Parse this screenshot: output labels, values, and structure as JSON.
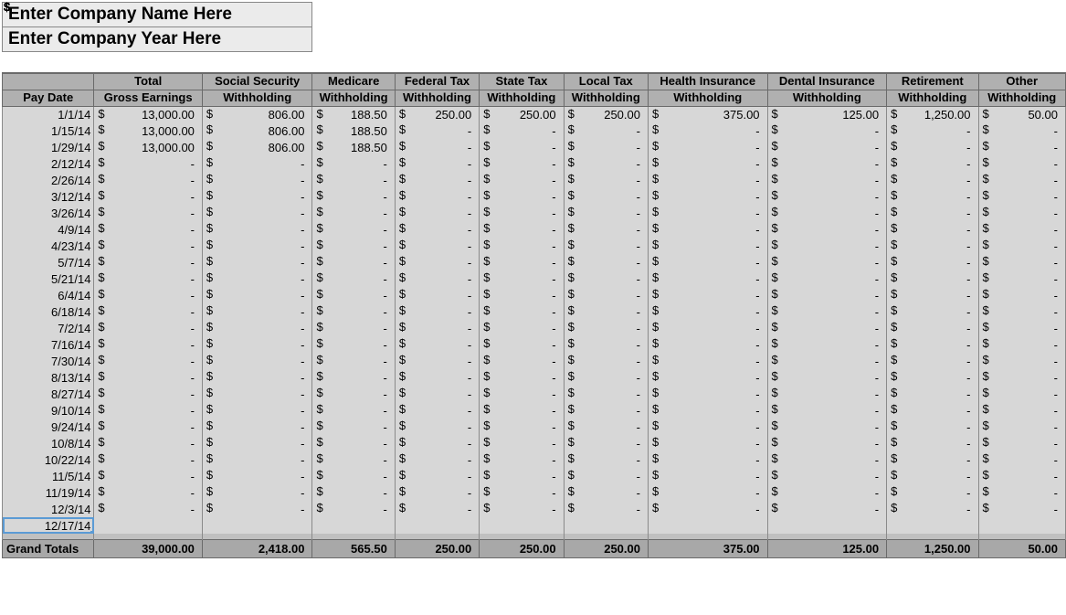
{
  "titles": {
    "company_name": "Enter Company Name Here",
    "company_year": "Enter Company Year Here"
  },
  "columns": [
    {
      "key": "date",
      "h1": "",
      "h2": "Pay Date",
      "cls": "c-date"
    },
    {
      "key": "gross",
      "h1": "Total",
      "h2": "Gross Earnings",
      "cls": "c-gross"
    },
    {
      "key": "ss",
      "h1": "Social Security",
      "h2": "Withholding",
      "cls": "c-ss"
    },
    {
      "key": "med",
      "h1": "Medicare",
      "h2": "Withholding",
      "cls": "c-med"
    },
    {
      "key": "fed",
      "h1": "Federal Tax",
      "h2": "Withholding",
      "cls": "c-fed"
    },
    {
      "key": "state",
      "h1": "State Tax",
      "h2": "Withholding",
      "cls": "c-state"
    },
    {
      "key": "local",
      "h1": "Local Tax",
      "h2": "Withholding",
      "cls": "c-local"
    },
    {
      "key": "health",
      "h1": "Health Insurance",
      "h2": "Withholding",
      "cls": "c-health"
    },
    {
      "key": "dental",
      "h1": "Dental Insurance",
      "h2": "Withholding",
      "cls": "c-dental"
    },
    {
      "key": "ret",
      "h1": "Retirement",
      "h2": "Withholding",
      "cls": "c-ret"
    },
    {
      "key": "other",
      "h1": "Other",
      "h2": "Withholding",
      "cls": "c-other"
    }
  ],
  "rows": [
    {
      "date": "1/1/14",
      "gross": "13,000.00",
      "ss": "806.00",
      "med": "188.50",
      "fed": "250.00",
      "state": "250.00",
      "local": "250.00",
      "health": "375.00",
      "dental": "125.00",
      "ret": "1,250.00",
      "other": "50.00"
    },
    {
      "date": "1/15/14",
      "gross": "13,000.00",
      "ss": "806.00",
      "med": "188.50",
      "fed": "-",
      "state": "-",
      "local": "-",
      "health": "-",
      "dental": "-",
      "ret": "-",
      "other": "-"
    },
    {
      "date": "1/29/14",
      "gross": "13,000.00",
      "ss": "806.00",
      "med": "188.50",
      "fed": "-",
      "state": "-",
      "local": "-",
      "health": "-",
      "dental": "-",
      "ret": "-",
      "other": "-"
    },
    {
      "date": "2/12/14",
      "gross": "-",
      "ss": "-",
      "med": "-",
      "fed": "-",
      "state": "-",
      "local": "-",
      "health": "-",
      "dental": "-",
      "ret": "-",
      "other": "-"
    },
    {
      "date": "2/26/14",
      "gross": "-",
      "ss": "-",
      "med": "-",
      "fed": "-",
      "state": "-",
      "local": "-",
      "health": "-",
      "dental": "-",
      "ret": "-",
      "other": "-"
    },
    {
      "date": "3/12/14",
      "gross": "-",
      "ss": "-",
      "med": "-",
      "fed": "-",
      "state": "-",
      "local": "-",
      "health": "-",
      "dental": "-",
      "ret": "-",
      "other": "-"
    },
    {
      "date": "3/26/14",
      "gross": "-",
      "ss": "-",
      "med": "-",
      "fed": "-",
      "state": "-",
      "local": "-",
      "health": "-",
      "dental": "-",
      "ret": "-",
      "other": "-"
    },
    {
      "date": "4/9/14",
      "gross": "-",
      "ss": "-",
      "med": "-",
      "fed": "-",
      "state": "-",
      "local": "-",
      "health": "-",
      "dental": "-",
      "ret": "-",
      "other": "-"
    },
    {
      "date": "4/23/14",
      "gross": "-",
      "ss": "-",
      "med": "-",
      "fed": "-",
      "state": "-",
      "local": "-",
      "health": "-",
      "dental": "-",
      "ret": "-",
      "other": "-"
    },
    {
      "date": "5/7/14",
      "gross": "-",
      "ss": "-",
      "med": "-",
      "fed": "-",
      "state": "-",
      "local": "-",
      "health": "-",
      "dental": "-",
      "ret": "-",
      "other": "-"
    },
    {
      "date": "5/21/14",
      "gross": "-",
      "ss": "-",
      "med": "-",
      "fed": "-",
      "state": "-",
      "local": "-",
      "health": "-",
      "dental": "-",
      "ret": "-",
      "other": "-"
    },
    {
      "date": "6/4/14",
      "gross": "-",
      "ss": "-",
      "med": "-",
      "fed": "-",
      "state": "-",
      "local": "-",
      "health": "-",
      "dental": "-",
      "ret": "-",
      "other": "-"
    },
    {
      "date": "6/18/14",
      "gross": "-",
      "ss": "-",
      "med": "-",
      "fed": "-",
      "state": "-",
      "local": "-",
      "health": "-",
      "dental": "-",
      "ret": "-",
      "other": "-"
    },
    {
      "date": "7/2/14",
      "gross": "-",
      "ss": "-",
      "med": "-",
      "fed": "-",
      "state": "-",
      "local": "-",
      "health": "-",
      "dental": "-",
      "ret": "-",
      "other": "-"
    },
    {
      "date": "7/16/14",
      "gross": "-",
      "ss": "-",
      "med": "-",
      "fed": "-",
      "state": "-",
      "local": "-",
      "health": "-",
      "dental": "-",
      "ret": "-",
      "other": "-"
    },
    {
      "date": "7/30/14",
      "gross": "-",
      "ss": "-",
      "med": "-",
      "fed": "-",
      "state": "-",
      "local": "-",
      "health": "-",
      "dental": "-",
      "ret": "-",
      "other": "-"
    },
    {
      "date": "8/13/14",
      "gross": "-",
      "ss": "-",
      "med": "-",
      "fed": "-",
      "state": "-",
      "local": "-",
      "health": "-",
      "dental": "-",
      "ret": "-",
      "other": "-"
    },
    {
      "date": "8/27/14",
      "gross": "-",
      "ss": "-",
      "med": "-",
      "fed": "-",
      "state": "-",
      "local": "-",
      "health": "-",
      "dental": "-",
      "ret": "-",
      "other": "-"
    },
    {
      "date": "9/10/14",
      "gross": "-",
      "ss": "-",
      "med": "-",
      "fed": "-",
      "state": "-",
      "local": "-",
      "health": "-",
      "dental": "-",
      "ret": "-",
      "other": "-"
    },
    {
      "date": "9/24/14",
      "gross": "-",
      "ss": "-",
      "med": "-",
      "fed": "-",
      "state": "-",
      "local": "-",
      "health": "-",
      "dental": "-",
      "ret": "-",
      "other": "-"
    },
    {
      "date": "10/8/14",
      "gross": "-",
      "ss": "-",
      "med": "-",
      "fed": "-",
      "state": "-",
      "local": "-",
      "health": "-",
      "dental": "-",
      "ret": "-",
      "other": "-"
    },
    {
      "date": "10/22/14",
      "gross": "-",
      "ss": "-",
      "med": "-",
      "fed": "-",
      "state": "-",
      "local": "-",
      "health": "-",
      "dental": "-",
      "ret": "-",
      "other": "-"
    },
    {
      "date": "11/5/14",
      "gross": "-",
      "ss": "-",
      "med": "-",
      "fed": "-",
      "state": "-",
      "local": "-",
      "health": "-",
      "dental": "-",
      "ret": "-",
      "other": "-"
    },
    {
      "date": "11/19/14",
      "gross": "-",
      "ss": "-",
      "med": "-",
      "fed": "-",
      "state": "-",
      "local": "-",
      "health": "-",
      "dental": "-",
      "ret": "-",
      "other": "-"
    },
    {
      "date": "12/3/14",
      "gross": "-",
      "ss": "-",
      "med": "-",
      "fed": "-",
      "state": "-",
      "local": "-",
      "health": "-",
      "dental": "-",
      "ret": "-",
      "other": "-"
    },
    {
      "date": "12/17/14",
      "gross": "",
      "ss": "",
      "med": "",
      "fed": "",
      "state": "",
      "local": "",
      "health": "",
      "dental": "",
      "ret": "",
      "other": "",
      "selected": true,
      "nosym": true
    }
  ],
  "totals": {
    "label": "Grand Totals",
    "gross": "39,000.00",
    "ss": "2,418.00",
    "med": "565.50",
    "fed": "250.00",
    "state": "250.00",
    "local": "250.00",
    "health": "375.00",
    "dental": "125.00",
    "ret": "1,250.00",
    "other": "50.00"
  }
}
